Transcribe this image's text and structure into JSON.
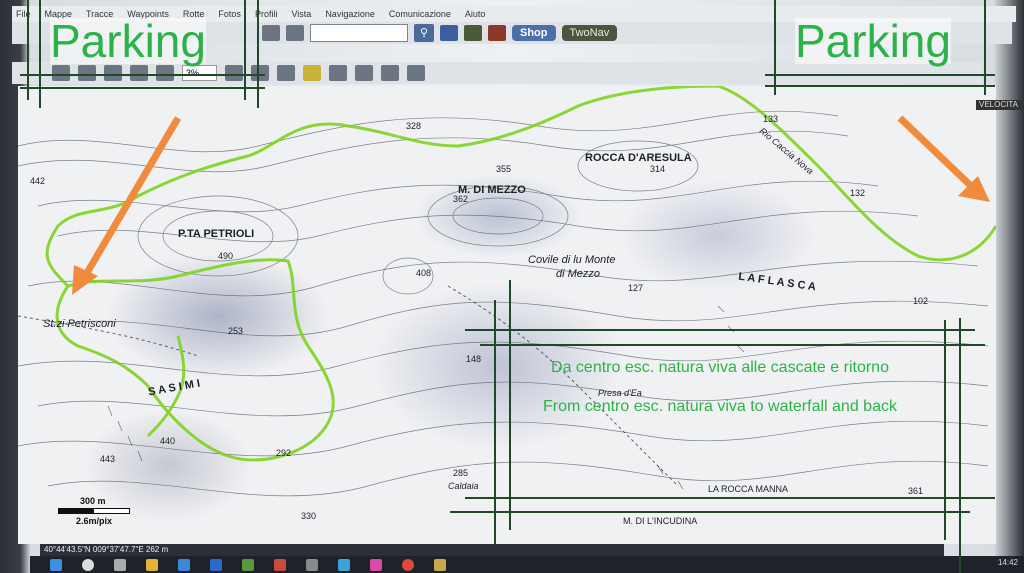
{
  "menubar": {
    "items": [
      "File",
      "Mappe",
      "Tracce",
      "Waypoints",
      "Rotte",
      "Fotos",
      "Profili",
      "Vista",
      "Navigazione",
      "Comunicazione",
      "Aiuto"
    ]
  },
  "toolbar": {
    "shop_label": "Shop",
    "twonav_label": "TwoNav",
    "zoom_value": "3%"
  },
  "overlay": {
    "parking_left": "Parking",
    "parking_right": "Parking",
    "caption_it": "Da centro esc. natura viva alle cascate e ritorno",
    "caption_en": "From centro esc. natura viva to waterfall and back",
    "arrow_color": "#f08a3c",
    "text_color": "#2db24a",
    "frame_color": "#1f4a2a"
  },
  "map": {
    "labels": {
      "rocca": "ROCCA D'ARESULA",
      "mdimezzo": "M. DI MEZZO",
      "petrioli": "P.TA PETRIOLI",
      "petrisconi": "St.zi Petrisconi",
      "covile": "Covile di lu Monte",
      "dimezzo": "di Mezzo",
      "flasca": "L A   F L A S C A",
      "rocca_manna": "LA ROCCA MANNA",
      "incudina": "M. DI L'INCUDINA",
      "fosso": "Rio Caccia Nova",
      "sasimi": "S A S I M I",
      "caldaia": "Caldaia",
      "presa": "Presa d'Ea",
      "elev_442": "442",
      "elev_355": "355",
      "elev_362": "362",
      "elev_314": "314",
      "elev_328": "328",
      "elev_408": "408",
      "elev_490": "490",
      "elev_253": "253",
      "elev_127": "127",
      "elev_133": "133",
      "elev_132": "132",
      "elev_102": "102",
      "elev_148": "148",
      "elev_285": "285",
      "elev_292": "292",
      "elev_330": "330",
      "elev_361": "361",
      "elev_440": "440",
      "elev_443": "443"
    },
    "scale_distance": "300 m",
    "scale_resolution": "2.6m/pix",
    "velocity_label": "VELOCITA"
  },
  "statusbar": {
    "coords": "40°44'43.5\"N 009°37'47.7\"E  262 m"
  },
  "taskbar": {
    "clock": "14:42"
  }
}
